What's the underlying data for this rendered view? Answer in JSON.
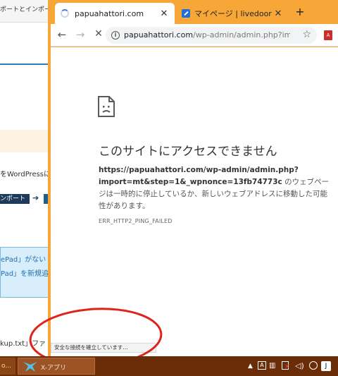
{
  "background_window": {
    "tab_text": "ポートとインポート | C",
    "wp_line": "をWordPressに",
    "dark_button": "ンポート",
    "info_line_1": "ePad」がない",
    "info_line_2": "Pad」を新規追",
    "file_line": "kup.txt」ファ"
  },
  "browser": {
    "tabs": [
      {
        "title": "papuahattori.com",
        "state": "loading"
      },
      {
        "title": "マイページ | livedoor Blog"
      }
    ],
    "new_tab_label": "+",
    "close_label": "✕",
    "url_host": "papuahattori.com",
    "url_path": "/wp-admin/admin.php?import=…",
    "ext_label": "A"
  },
  "error_page": {
    "title": "このサイトにアクセスできません",
    "url": "https://papuahattori.com/wp-admin/admin.php?import=mt&step=1&_wpnonce=13fb74773c",
    "message": " のウェブページは一時的に停止しているか、新しいウェブアドレスに移動した可能性があります。",
    "code": "ERR_HTTP2_PING_FAILED"
  },
  "status_bubble": "安全な接続を確立しています…",
  "taskbar": {
    "left_label": "o...",
    "app_label": "X-アプリ",
    "ime_label": "J",
    "tray_a": "A"
  },
  "colors": {
    "chrome_frame": "#f6a737",
    "taskbar": "#6b2c08",
    "annotation": "#e0221b"
  }
}
